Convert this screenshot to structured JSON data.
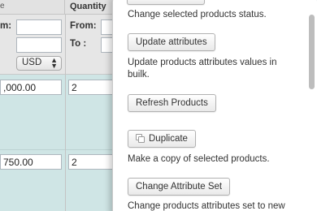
{
  "grid": {
    "header": {
      "sort_arrow": "e",
      "quantity_col": "Quantity"
    },
    "filter": {
      "from_label_left": "m:",
      "from_label": "From:",
      "to_label": "To :",
      "currency": "USD"
    },
    "rows": [
      {
        "price": ",000.00",
        "quantity": "2"
      },
      {
        "price": "750.00",
        "quantity": "2"
      }
    ]
  },
  "panel": {
    "top_desc": "Change selected products status.",
    "actions": [
      {
        "label": "Update attributes",
        "desc_line1": "Update products attributes values in",
        "desc_line2": "builk."
      },
      {
        "label": "Refresh Products"
      },
      {
        "label": "Duplicate",
        "icon": "copy-icon",
        "desc_line1": "Make a copy of selected products."
      },
      {
        "label": "Change Attribute Set",
        "desc_line1": "Change products attributes set to new"
      }
    ]
  }
}
